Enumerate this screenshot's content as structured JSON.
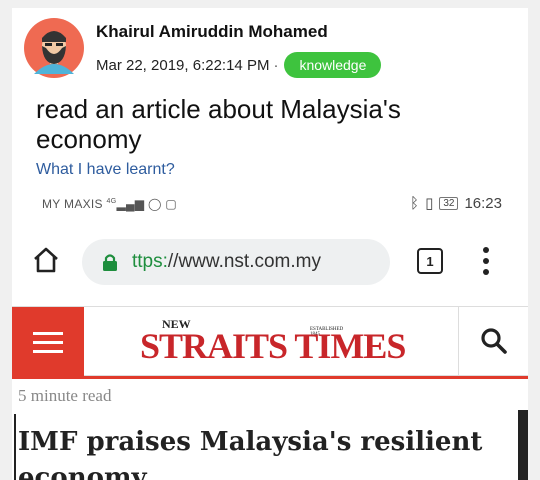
{
  "post": {
    "author": "Khairul Amiruddin Mohamed",
    "timestamp": "Mar 22, 2019, 6:22:14 PM",
    "separator": "·",
    "tag": "knowledge",
    "title": "read an article about Malaysia's economy",
    "subtitle": "What I have learnt?",
    "tag_color": "#3ec33e",
    "avatar_icon": "bearded-man-avatar"
  },
  "phone": {
    "status": {
      "carrier": "MY MAXIS",
      "network": "4G",
      "battery": "32",
      "time": "16:23"
    },
    "browser": {
      "url_scheme": "ttps:",
      "url_rest": "//www.nst.com.my",
      "tab_count": "1"
    },
    "site": {
      "logo_new": "NEW",
      "logo_main": "STRAITS TIMES",
      "logo_est": "ESTABLISHED 1845",
      "accent_color": "#e03a2c"
    },
    "article": {
      "read_time": "5 minute read",
      "headline": "IMF praises Malaysia's resilient economy"
    }
  }
}
